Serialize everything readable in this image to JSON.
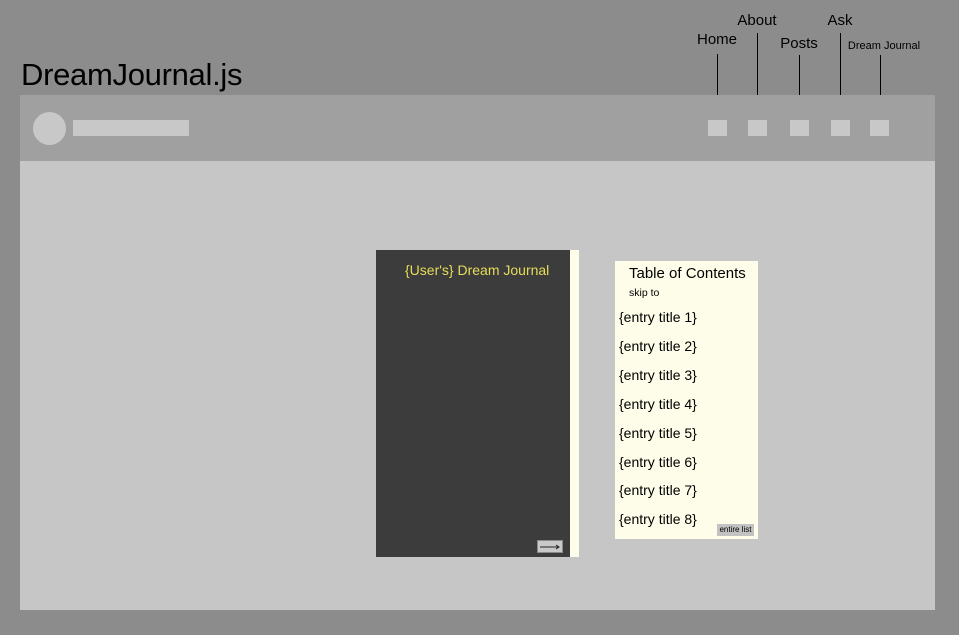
{
  "app": {
    "title": "DreamJournal.js"
  },
  "nav": {
    "home_label": "Home",
    "about_label": "About",
    "posts_label": "Posts",
    "ask_label": "Ask",
    "dream_journal_label": "Dream Journal"
  },
  "journal": {
    "cover_title": "{User's} Dream Journal",
    "next_arrow": "⟶"
  },
  "toc": {
    "title": "Table of Contents",
    "subtitle": "skip to",
    "entries": [
      "{entry title 1}",
      "{entry title 2}",
      "{entry title 3}",
      "{entry title 4}",
      "{entry title 5}",
      "{entry title 6}",
      "{entry title 7}",
      "{entry title 8}"
    ],
    "entire_list_label": "entire list"
  },
  "colors": {
    "background": "#8c8c8c",
    "frame": "#c6c6c6",
    "navbar": "#a0a0a0",
    "placeholder": "#c8c8c8",
    "journal_cover": "#3c3c3c",
    "journal_title": "#e6dc5a",
    "paper": "#fefde9"
  }
}
